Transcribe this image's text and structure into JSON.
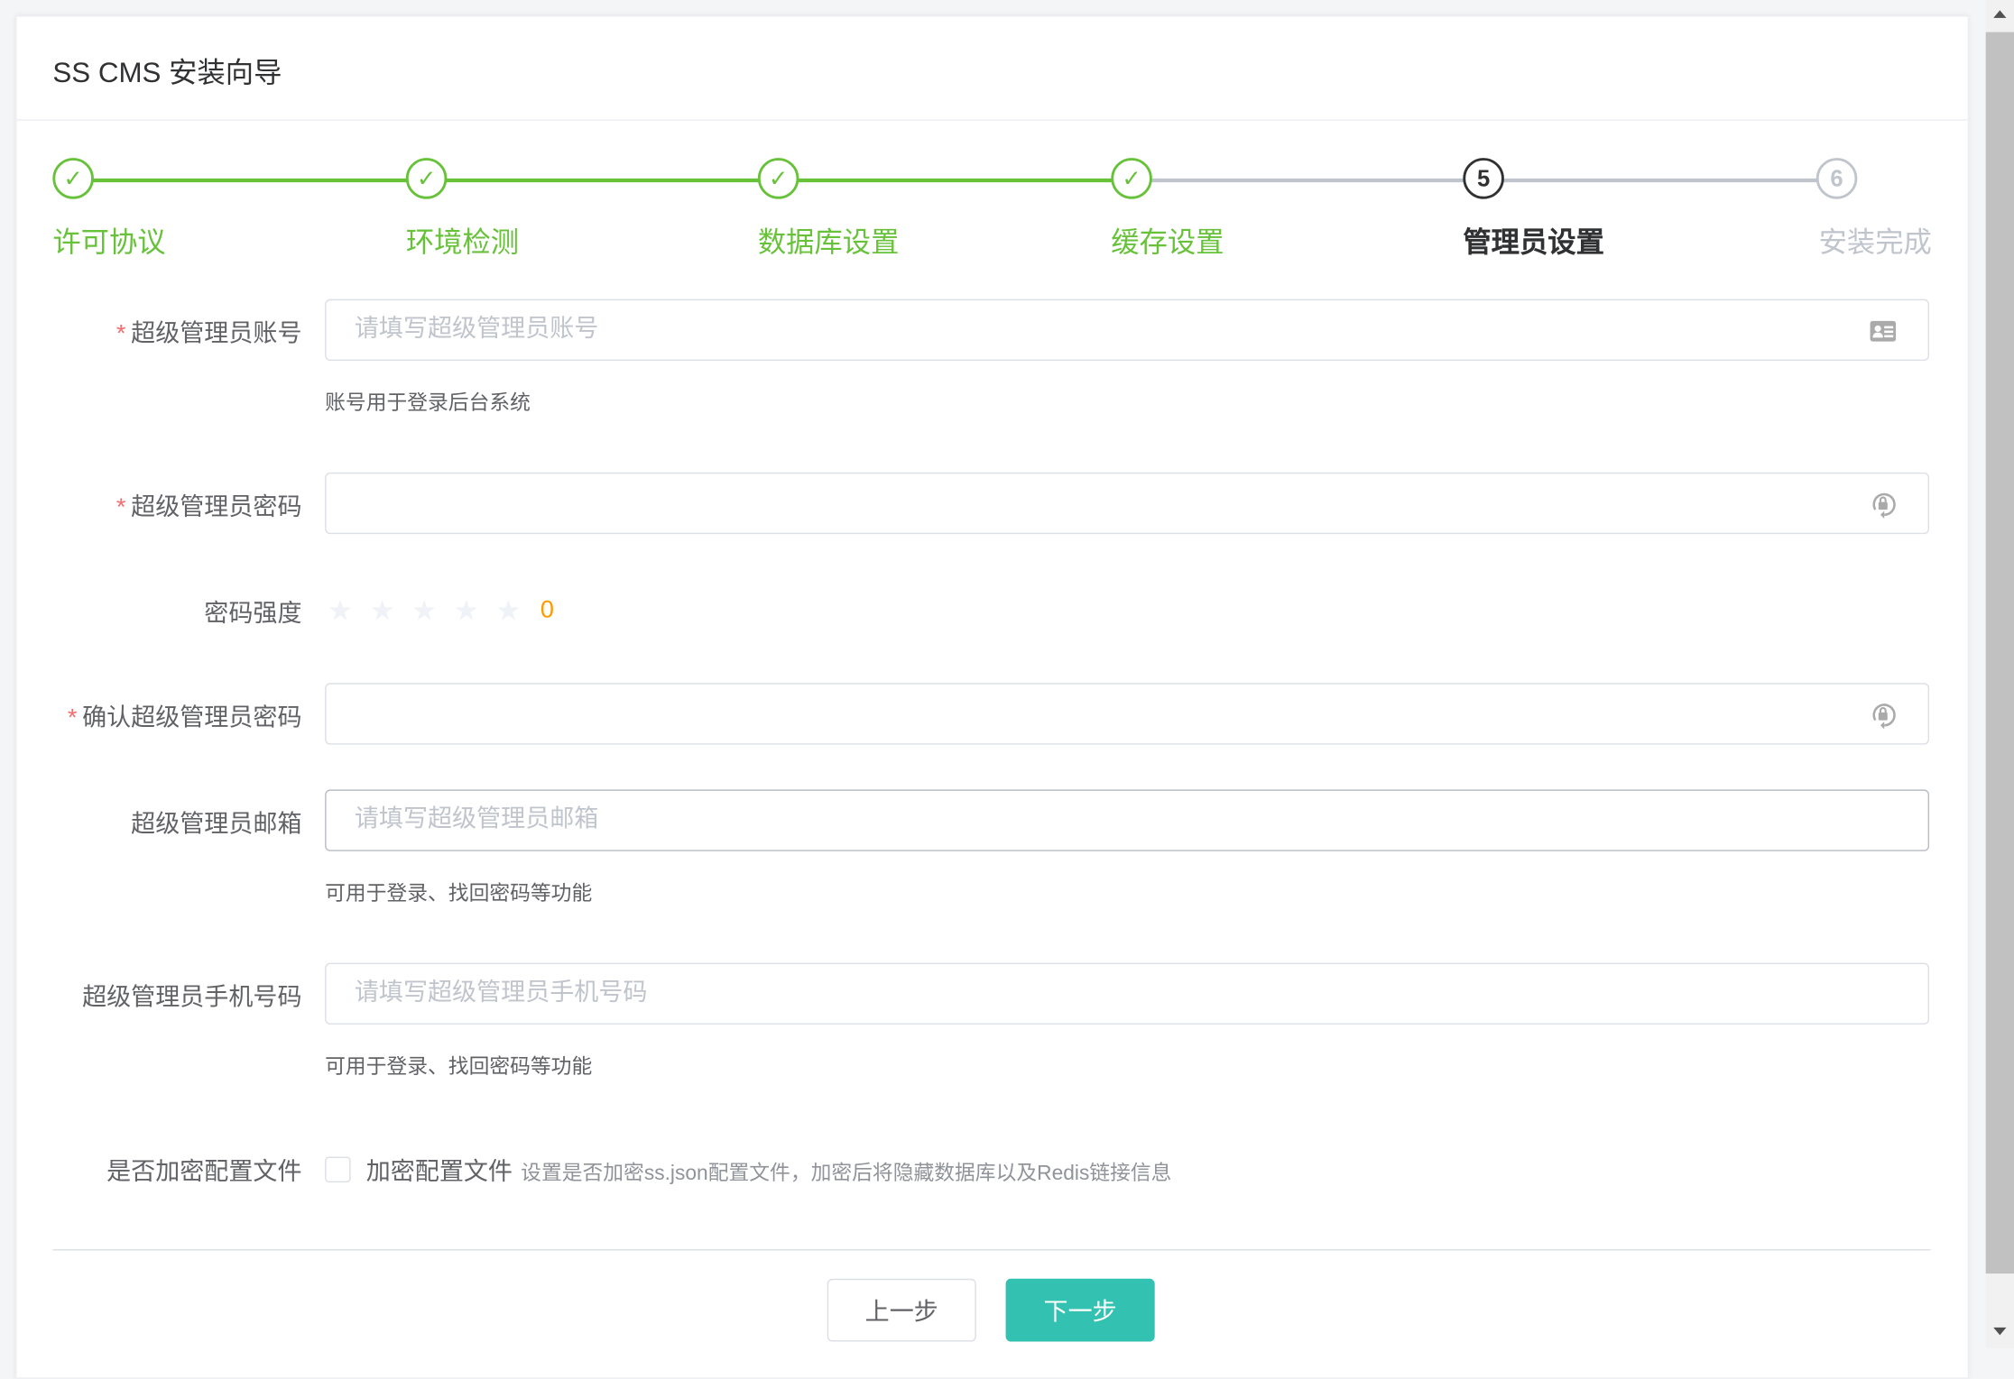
{
  "window": {
    "title": "SS CMS 安装向导"
  },
  "steps": [
    {
      "label": "许可协议",
      "status": "done"
    },
    {
      "label": "环境检测",
      "status": "done"
    },
    {
      "label": "数据库设置",
      "status": "done"
    },
    {
      "label": "缓存设置",
      "status": "done"
    },
    {
      "label": "管理员设置",
      "status": "active",
      "number": "5"
    },
    {
      "label": "安装完成",
      "status": "wait",
      "number": "6"
    }
  ],
  "colors": {
    "success": "#67c23a",
    "active": "#303133",
    "wait": "#c0c4cc",
    "primary": "#33c1b1",
    "required": "#f56c6c",
    "score": "#ff9900"
  },
  "form": {
    "account": {
      "label": "超级管理员账号",
      "placeholder": "请填写超级管理员账号",
      "value": "",
      "help": "账号用于登录后台系统"
    },
    "password": {
      "label": "超级管理员密码",
      "value": ""
    },
    "strength": {
      "label": "密码强度",
      "stars_total": 5,
      "stars_filled": 0,
      "score": "0"
    },
    "confirm": {
      "label": "确认超级管理员密码",
      "value": ""
    },
    "email": {
      "label": "超级管理员邮箱",
      "placeholder": "请填写超级管理员邮箱",
      "value": "",
      "help": "可用于登录、找回密码等功能"
    },
    "mobile": {
      "label": "超级管理员手机号码",
      "placeholder": "请填写超级管理员手机号码",
      "value": "",
      "help": "可用于登录、找回密码等功能"
    },
    "encrypt": {
      "label": "是否加密配置文件",
      "checkbox_label": "加密配置文件",
      "checked": false,
      "help": "设置是否加密ss.json配置文件，加密后将隐藏数据库以及Redis链接信息"
    }
  },
  "buttons": {
    "prev": "上一步",
    "next": "下一步"
  }
}
